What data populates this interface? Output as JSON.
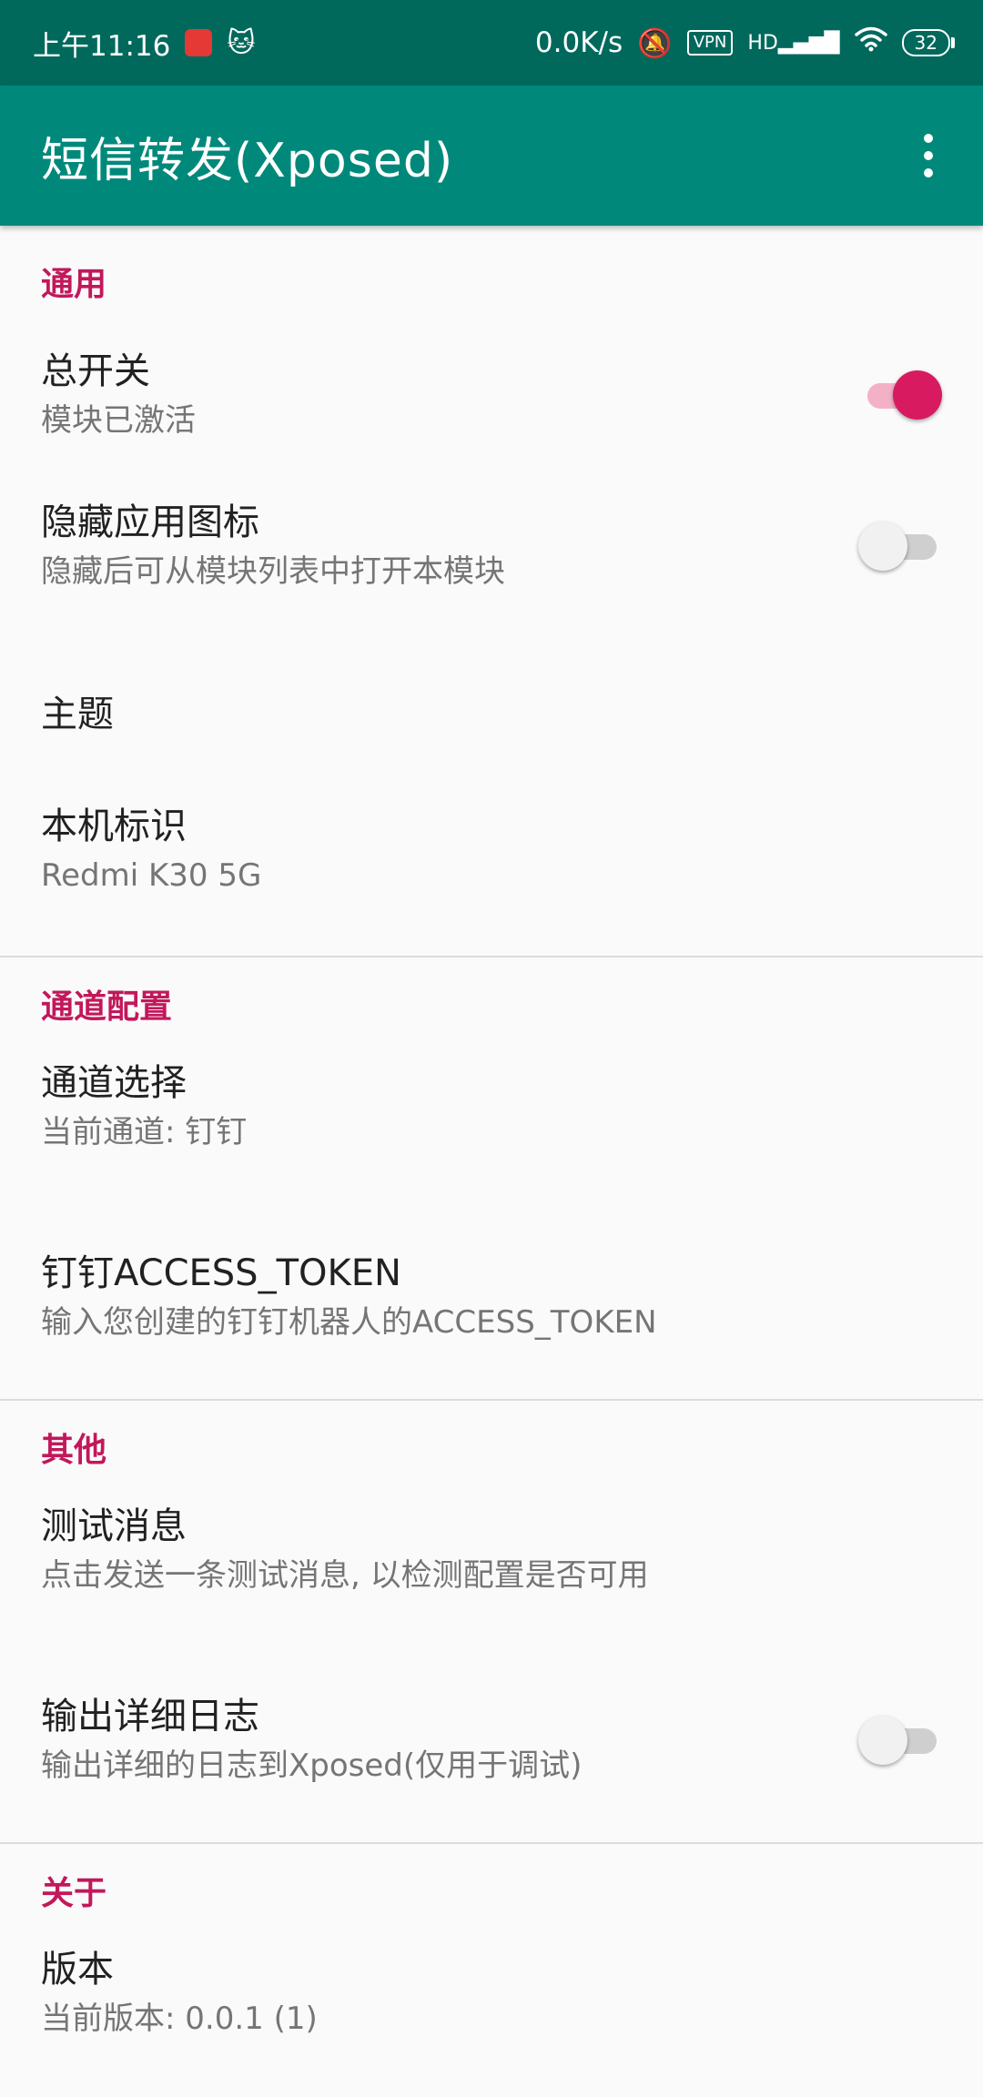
{
  "status_bar": {
    "time": "上午11:16",
    "net_speed": "0.0K/s",
    "vpn": "VPN",
    "signal": "HD",
    "battery": "32"
  },
  "app_bar": {
    "title": "短信转发(Xposed)"
  },
  "categories": {
    "general": {
      "title": "通用",
      "master_switch": {
        "title": "总开关",
        "summary": "模块已激活",
        "checked": true
      },
      "hide_icon": {
        "title": "隐藏应用图标",
        "summary": "隐藏后可从模块列表中打开本模块",
        "checked": false
      },
      "theme": {
        "title": "主题"
      },
      "device_id": {
        "title": "本机标识",
        "summary": "Redmi K30 5G"
      }
    },
    "channel": {
      "title": "通道配置",
      "channel_select": {
        "title": "通道选择",
        "summary": "当前通道: 钉钉"
      },
      "dingtalk_token": {
        "title": "钉钉ACCESS_TOKEN",
        "summary": "输入您创建的钉钉机器人的ACCESS_TOKEN"
      }
    },
    "other": {
      "title": "其他",
      "test_message": {
        "title": "测试消息",
        "summary": "点击发送一条测试消息, 以检测配置是否可用"
      },
      "verbose_log": {
        "title": "输出详细日志",
        "summary": "输出详细的日志到Xposed(仅用于调试)",
        "checked": false
      }
    },
    "about": {
      "title": "关于",
      "version": {
        "title": "版本",
        "summary": "当前版本: 0.0.1 (1)"
      }
    }
  },
  "colors": {
    "status_bar": "#00695c",
    "app_bar": "#00897b",
    "accent": "#c2185b",
    "switch_on": "#d81b60"
  }
}
